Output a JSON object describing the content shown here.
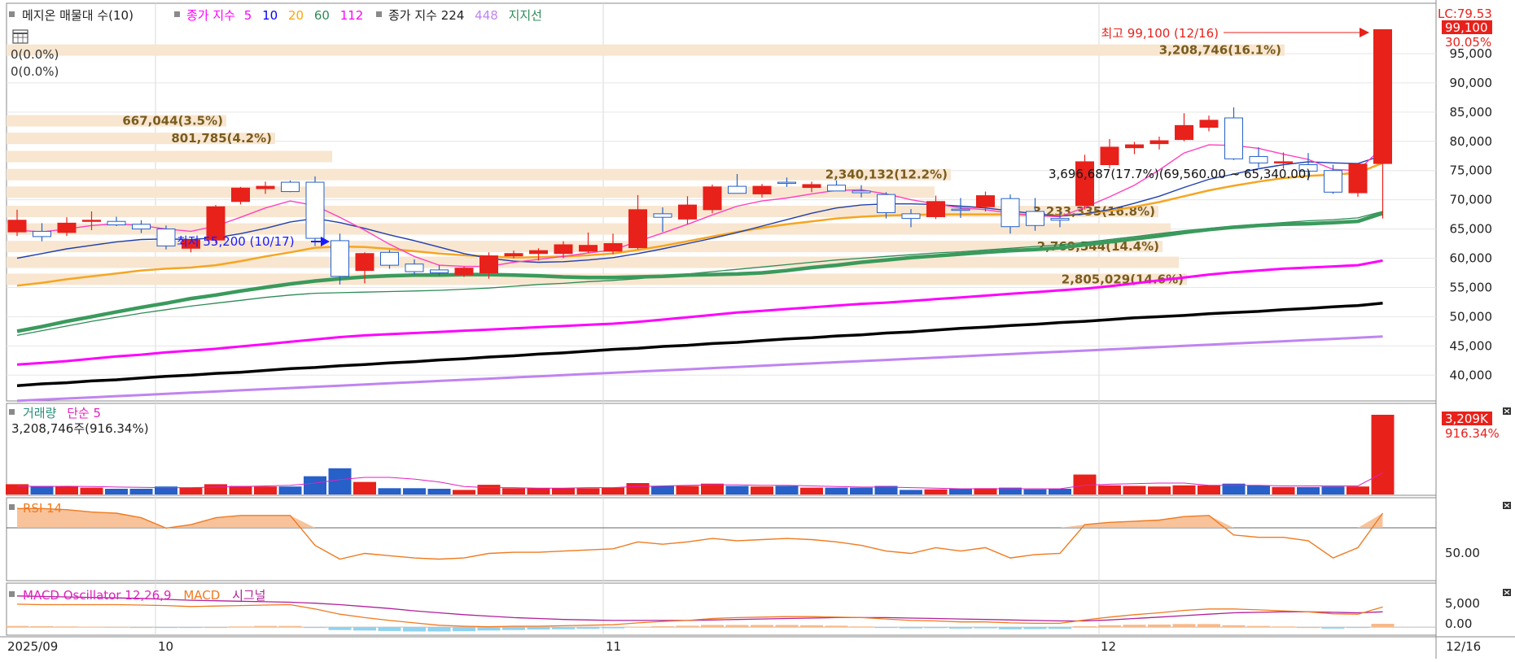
{
  "legend": {
    "title": "메지온 매물대 수(10)",
    "ma_label": "종가 지수",
    "ma_periods": [
      "5",
      "10",
      "20",
      "60",
      "112"
    ],
    "ma_colors": [
      "#ff00ff",
      "#0000ff",
      "#ffa500",
      "#2e8b57",
      "#ff00ff"
    ],
    "ma2_label": "종가 지수 224",
    "ma2_extra": "448",
    "support_label": "지지선"
  },
  "zero_labels": [
    "0(0.0%)",
    "0(0.0%)"
  ],
  "high_annotation": "최고 99,100 (12/16)",
  "low_annotation": "최저 55,200 (10/17)",
  "range_annotation": "3,696,687(17.7%)(69,560.00 ~ 65,340.00)",
  "right_badges": {
    "lc": "LC:79.53",
    "last": "99,100",
    "pct": "30.05%"
  },
  "date_labels": [
    "2025/09",
    "10",
    "11",
    "12",
    "12/16"
  ],
  "volume": {
    "label": "거래량",
    "ma_label": "단순 5",
    "last": "3,208,746주(916.34%)",
    "badge": "3,209K",
    "badge_pct": "916.34%"
  },
  "rsi": {
    "label": "RSI 14",
    "tick": "50.00"
  },
  "macd": {
    "label": "MACD Oscillator 12,26,9",
    "macd_label": "MACD",
    "signal_label": "시그널",
    "ticks": [
      "5,000",
      "0.00"
    ]
  },
  "colors": {
    "up": "#e8211b",
    "down": "#2660c8",
    "vp": "#f8e6d0"
  },
  "chart_data": {
    "type": "candlestick",
    "ylim": [
      36000,
      100000
    ],
    "yticks": [
      "40,000",
      "45,000",
      "50,000",
      "55,000",
      "60,000",
      "65,000",
      "70,000",
      "75,000",
      "80,000",
      "85,000",
      "90,000",
      "95,000"
    ],
    "candles": [
      {
        "o": 64500,
        "h": 68300,
        "l": 63800,
        "c": 66500
      },
      {
        "o": 64600,
        "h": 66000,
        "l": 62900,
        "c": 63700
      },
      {
        "o": 64400,
        "h": 67000,
        "l": 63800,
        "c": 66000
      },
      {
        "o": 66500,
        "h": 68000,
        "l": 64800,
        "c": 66500
      },
      {
        "o": 66300,
        "h": 67100,
        "l": 65500,
        "c": 65700
      },
      {
        "o": 65800,
        "h": 66500,
        "l": 64300,
        "c": 65000
      },
      {
        "o": 65000,
        "h": 65600,
        "l": 61500,
        "c": 62100
      },
      {
        "o": 61700,
        "h": 63200,
        "l": 61000,
        "c": 63100
      },
      {
        "o": 63100,
        "h": 69100,
        "l": 62600,
        "c": 68800
      },
      {
        "o": 69700,
        "h": 72200,
        "l": 69200,
        "c": 72000
      },
      {
        "o": 71900,
        "h": 73100,
        "l": 71000,
        "c": 72300
      },
      {
        "o": 73000,
        "h": 73300,
        "l": 71300,
        "c": 71400
      },
      {
        "o": 73000,
        "h": 74000,
        "l": 62100,
        "c": 63400
      },
      {
        "o": 63000,
        "h": 64200,
        "l": 55500,
        "c": 56900
      },
      {
        "o": 57900,
        "h": 61000,
        "l": 55700,
        "c": 60800
      },
      {
        "o": 61000,
        "h": 61400,
        "l": 58200,
        "c": 58800
      },
      {
        "o": 59000,
        "h": 59800,
        "l": 57200,
        "c": 57700
      },
      {
        "o": 58000,
        "h": 58800,
        "l": 57000,
        "c": 57500
      },
      {
        "o": 57200,
        "h": 58600,
        "l": 56800,
        "c": 58300
      },
      {
        "o": 57500,
        "h": 61000,
        "l": 56500,
        "c": 60400
      },
      {
        "o": 60400,
        "h": 61300,
        "l": 60000,
        "c": 60800
      },
      {
        "o": 60800,
        "h": 61700,
        "l": 59600,
        "c": 61300
      },
      {
        "o": 60800,
        "h": 62900,
        "l": 60000,
        "c": 62300
      },
      {
        "o": 61200,
        "h": 64400,
        "l": 60900,
        "c": 62200
      },
      {
        "o": 61200,
        "h": 64200,
        "l": 60700,
        "c": 62500
      },
      {
        "o": 61800,
        "h": 70800,
        "l": 61500,
        "c": 68300
      },
      {
        "o": 67600,
        "h": 68700,
        "l": 64500,
        "c": 67000
      },
      {
        "o": 66700,
        "h": 70600,
        "l": 65800,
        "c": 69100
      },
      {
        "o": 68300,
        "h": 72600,
        "l": 67700,
        "c": 72200
      },
      {
        "o": 72300,
        "h": 74400,
        "l": 71200,
        "c": 71100
      },
      {
        "o": 71000,
        "h": 72700,
        "l": 70400,
        "c": 72300
      },
      {
        "o": 73000,
        "h": 73800,
        "l": 72200,
        "c": 72900
      },
      {
        "o": 72100,
        "h": 73100,
        "l": 71300,
        "c": 72600
      },
      {
        "o": 72500,
        "h": 73300,
        "l": 71500,
        "c": 71500
      },
      {
        "o": 71500,
        "h": 72500,
        "l": 70400,
        "c": 71200
      },
      {
        "o": 70900,
        "h": 71300,
        "l": 66800,
        "c": 67800
      },
      {
        "o": 67600,
        "h": 68400,
        "l": 65300,
        "c": 66800
      },
      {
        "o": 67100,
        "h": 70700,
        "l": 66700,
        "c": 69700
      },
      {
        "o": 68400,
        "h": 70300,
        "l": 66900,
        "c": 68300
      },
      {
        "o": 68800,
        "h": 71400,
        "l": 68000,
        "c": 70700
      },
      {
        "o": 70200,
        "h": 70900,
        "l": 64200,
        "c": 65400
      },
      {
        "o": 68000,
        "h": 70300,
        "l": 64700,
        "c": 65600
      },
      {
        "o": 66800,
        "h": 68000,
        "l": 65300,
        "c": 66500
      },
      {
        "o": 69000,
        "h": 77700,
        "l": 68300,
        "c": 76500
      },
      {
        "o": 76000,
        "h": 80400,
        "l": 75400,
        "c": 79000
      },
      {
        "o": 78900,
        "h": 79900,
        "l": 77800,
        "c": 79400
      },
      {
        "o": 79600,
        "h": 80800,
        "l": 78600,
        "c": 80100
      },
      {
        "o": 80300,
        "h": 84800,
        "l": 80000,
        "c": 82700
      },
      {
        "o": 82400,
        "h": 84400,
        "l": 81700,
        "c": 83600
      },
      {
        "o": 84000,
        "h": 85800,
        "l": 76800,
        "c": 77000
      },
      {
        "o": 77400,
        "h": 79000,
        "l": 75500,
        "c": 76300
      },
      {
        "o": 76300,
        "h": 78100,
        "l": 75300,
        "c": 76500
      },
      {
        "o": 76000,
        "h": 78000,
        "l": 73300,
        "c": 74900
      },
      {
        "o": 75000,
        "h": 76000,
        "l": 71000,
        "c": 71300
      },
      {
        "o": 71200,
        "h": 76100,
        "l": 70500,
        "c": 76100
      },
      {
        "o": 76200,
        "h": 99100,
        "l": 66800,
        "c": 99100
      }
    ],
    "ma5": [
      64800,
      64500,
      65000,
      65600,
      65900,
      65600,
      65000,
      64600,
      65500,
      67000,
      68600,
      69800,
      69000,
      67000,
      64800,
      62400,
      60300,
      58800,
      58600,
      58600,
      59300,
      59800,
      60300,
      60900,
      61400,
      62900,
      64300,
      65800,
      67400,
      68900,
      69800,
      70300,
      71000,
      71600,
      71700,
      71000,
      70000,
      69300,
      68600,
      68300,
      67700,
      67300,
      67100,
      68700,
      70500,
      72500,
      75100,
      78000,
      79400,
      79300,
      78800,
      77800,
      76900,
      75200,
      75000,
      79000
    ],
    "ma10": [
      60000,
      60800,
      61600,
      62200,
      62800,
      63200,
      63300,
      63200,
      63500,
      64200,
      65100,
      66200,
      66800,
      66100,
      65100,
      64000,
      63000,
      61900,
      60800,
      60000,
      59500,
      59300,
      59400,
      59700,
      60100,
      60800,
      61600,
      62500,
      63400,
      64400,
      65500,
      66600,
      67700,
      68600,
      69100,
      69300,
      69300,
      69200,
      68900,
      68600,
      68100,
      67600,
      67200,
      67600,
      68300,
      69400,
      70600,
      72100,
      73500,
      74400,
      75300,
      76000,
      76500,
      76300,
      76200,
      77600
    ],
    "ma20": [
      55300,
      55800,
      56400,
      56900,
      57400,
      57900,
      58200,
      58400,
      58800,
      59500,
      60300,
      61000,
      61800,
      62000,
      61900,
      61600,
      61200,
      60800,
      60500,
      60300,
      60100,
      60200,
      60300,
      60500,
      60800,
      61400,
      62100,
      62900,
      63700,
      64500,
      65200,
      65800,
      66300,
      66800,
      67100,
      67300,
      67400,
      67500,
      67500,
      67500,
      67500,
      67400,
      67300,
      67600,
      68100,
      68800,
      69600,
      70600,
      71600,
      72400,
      73100,
      73700,
      74100,
      74300,
      74600,
      76300
    ],
    "ma60": [
      46800,
      47600,
      48400,
      49200,
      49900,
      50600,
      51200,
      51800,
      52300,
      52800,
      53300,
      53700,
      54000,
      54100,
      54200,
      54300,
      54400,
      54500,
      54700,
      54900,
      55200,
      55500,
      55700,
      56000,
      56200,
      56500,
      56900,
      57300,
      57700,
      58100,
      58500,
      58900,
      59300,
      59700,
      60000,
      60300,
      60600,
      60900,
      61100,
      61400,
      61700,
      62000,
      62300,
      62700,
      63200,
      63700,
      64200,
      64700,
      65100,
      65500,
      65800,
      66100,
      66400,
      66600,
      66900,
      68000
    ],
    "support": [
      47500,
      48300,
      49200,
      50000,
      50800,
      51600,
      52300,
      53100,
      53700,
      54400,
      55000,
      55600,
      56100,
      56500,
      56800,
      57000,
      57100,
      57100,
      57200,
      57200,
      57100,
      57000,
      56800,
      56700,
      56700,
      56800,
      56900,
      57100,
      57200,
      57300,
      57500,
      57900,
      58400,
      58800,
      59300,
      59700,
      60100,
      60400,
      60700,
      61000,
      61300,
      61500,
      61800,
      62300,
      62800,
      63300,
      63800,
      64400,
      64900,
      65300,
      65600,
      65800,
      65900,
      66100,
      66300,
      67700
    ],
    "ma112": [
      41800,
      42100,
      42400,
      42800,
      43200,
      43500,
      43900,
      44200,
      44500,
      44900,
      45300,
      45700,
      46100,
      46500,
      46800,
      47000,
      47200,
      47400,
      47600,
      47800,
      48000,
      48200,
      48400,
      48600,
      48800,
      49100,
      49500,
      49900,
      50300,
      50700,
      51000,
      51300,
      51600,
      51900,
      52200,
      52400,
      52700,
      53000,
      53300,
      53600,
      53900,
      54200,
      54500,
      54800,
      55200,
      55700,
      56200,
      56700,
      57200,
      57600,
      57900,
      58200,
      58400,
      58600,
      58800,
      59600
    ],
    "ma224": [
      38200,
      38500,
      38700,
      39000,
      39200,
      39500,
      39800,
      40000,
      40300,
      40500,
      40800,
      41100,
      41300,
      41600,
      41800,
      42100,
      42300,
      42600,
      42800,
      43100,
      43300,
      43600,
      43800,
      44100,
      44400,
      44600,
      44900,
      45100,
      45400,
      45600,
      45900,
      46200,
      46400,
      46700,
      46900,
      47200,
      47400,
      47700,
      48000,
      48200,
      48500,
      48700,
      49000,
      49200,
      49500,
      49800,
      50000,
      50200,
      50500,
      50700,
      50900,
      51200,
      51400,
      51700,
      51900,
      52300
    ],
    "ma448": [
      35600,
      35800,
      36000,
      36200,
      36400,
      36600,
      36800,
      37000,
      37200,
      37400,
      37600,
      37800,
      38000,
      38200,
      38400,
      38600,
      38800,
      39000,
      39200,
      39400,
      39600,
      39800,
      40000,
      40200,
      40400,
      40600,
      40800,
      41000,
      41200,
      41400,
      41600,
      41800,
      42000,
      42200,
      42400,
      42600,
      42800,
      43000,
      43200,
      43400,
      43600,
      43800,
      44000,
      44200,
      44400,
      44600,
      44800,
      45000,
      45200,
      45400,
      45600,
      45800,
      46000,
      46200,
      46400,
      46600
    ],
    "volume_profile": [
      {
        "p": 56400,
        "len": 1450
      },
      {
        "p": 59300,
        "len": 1440
      },
      {
        "p": 62000,
        "len": 1420
      },
      {
        "p": 65000,
        "len": 1430
      },
      {
        "p": 68000,
        "len": 1415
      },
      {
        "p": 71300,
        "len": 1140
      },
      {
        "p": 74300,
        "len": 1160
      },
      {
        "p": 77400,
        "len": 400
      },
      {
        "p": 80500,
        "len": 330
      },
      {
        "p": 83500,
        "len": 270
      },
      {
        "p": 86500,
        "len": 0
      },
      {
        "p": 89500,
        "len": 0
      },
      {
        "p": 92600,
        "len": 0
      },
      {
        "p": 95600,
        "len": 1570
      }
    ],
    "vp_labels": [
      {
        "p": 95600,
        "text": "3,208,746(16.1%)"
      },
      {
        "p": 83500,
        "text": "667,044(3.5%)"
      },
      {
        "p": 80500,
        "text": "801,785(4.2%)"
      },
      {
        "p": 74300,
        "text": "2,340,132(12.2%)"
      },
      {
        "p": 68000,
        "text": "3,233,335(16.8%)"
      },
      {
        "p": 62000,
        "text": "2,769,544(14.4%)"
      },
      {
        "p": 56400,
        "text": "2,805,029(14.6%)"
      }
    ],
    "volumes": [
      180,
      150,
      150,
      120,
      100,
      100,
      140,
      120,
      180,
      150,
      140,
      140,
      320,
      460,
      220,
      110,
      110,
      100,
      80,
      170,
      110,
      110,
      110,
      110,
      120,
      200,
      150,
      150,
      190,
      150,
      140,
      150,
      120,
      120,
      120,
      150,
      80,
      90,
      100,
      110,
      120,
      90,
      100,
      350,
      160,
      150,
      140,
      160,
      160,
      190,
      160,
      130,
      130,
      140,
      140,
      1400
    ],
    "volume_ma5": [
      150,
      140,
      145,
      140,
      130,
      125,
      120,
      120,
      130,
      140,
      150,
      160,
      200,
      260,
      300,
      300,
      270,
      220,
      140,
      120,
      120,
      110,
      110,
      120,
      120,
      140,
      150,
      160,
      170,
      170,
      160,
      160,
      150,
      140,
      130,
      130,
      120,
      110,
      100,
      100,
      100,
      100,
      100,
      160,
      180,
      190,
      200,
      200,
      160,
      160,
      160,
      150,
      150,
      150,
      150,
      380
    ],
    "vol_ylim": [
      0,
      1400
    ],
    "rsi_values": [
      92,
      92,
      91,
      89,
      88,
      84,
      75,
      78,
      84,
      86,
      86,
      86,
      60,
      48,
      53,
      51,
      49,
      48,
      49,
      53,
      54,
      54,
      55,
      56,
      57,
      63,
      61,
      63,
      66,
      64,
      65,
      66,
      65,
      63,
      60,
      55,
      53,
      58,
      55,
      58,
      49,
      52,
      53,
      78,
      80,
      81,
      82,
      85,
      86,
      69,
      67,
      67,
      64,
      49,
      58,
      88
    ],
    "rsi_ylim": [
      30,
      100
    ],
    "macd_osc": [
      250,
      200,
      150,
      100,
      60,
      0,
      -100,
      -100,
      0,
      150,
      250,
      250,
      -100,
      -600,
      -700,
      -800,
      -900,
      -900,
      -850,
      -700,
      -600,
      -500,
      -450,
      -350,
      -250,
      100,
      200,
      300,
      450,
      450,
      450,
      450,
      400,
      300,
      150,
      -100,
      -250,
      -200,
      -300,
      -250,
      -450,
      -400,
      -350,
      200,
      400,
      500,
      550,
      650,
      650,
      400,
      250,
      150,
      0,
      -300,
      -150,
      700
    ],
    "macd_line": [
      4800,
      4700,
      4700,
      4700,
      4700,
      4600,
      4500,
      4300,
      4400,
      4500,
      4600,
      4700,
      3800,
      2700,
      2000,
      1400,
      900,
      400,
      200,
      100,
      200,
      200,
      300,
      400,
      500,
      900,
      1200,
      1400,
      1800,
      2000,
      2100,
      2200,
      2200,
      2100,
      2000,
      1700,
      1400,
      1300,
      1100,
      1100,
      900,
      800,
      800,
      1500,
      2100,
      2600,
      3000,
      3500,
      3800,
      3800,
      3600,
      3400,
      3200,
      2800,
      2700,
      4200
    ],
    "macd_signal": [
      6500,
      6400,
      6300,
      6200,
      6100,
      6000,
      5800,
      5600,
      5500,
      5400,
      5300,
      5200,
      5000,
      4700,
      4300,
      3900,
      3400,
      3000,
      2600,
      2300,
      2000,
      1800,
      1600,
      1500,
      1400,
      1400,
      1400,
      1400,
      1500,
      1600,
      1700,
      1800,
      1900,
      2000,
      2000,
      2000,
      1900,
      1800,
      1700,
      1600,
      1500,
      1400,
      1300,
      1300,
      1500,
      1800,
      2100,
      2400,
      2700,
      3000,
      3100,
      3200,
      3200,
      3100,
      3000,
      3200
    ],
    "macd_ylim": [
      -1500,
      8000
    ]
  }
}
